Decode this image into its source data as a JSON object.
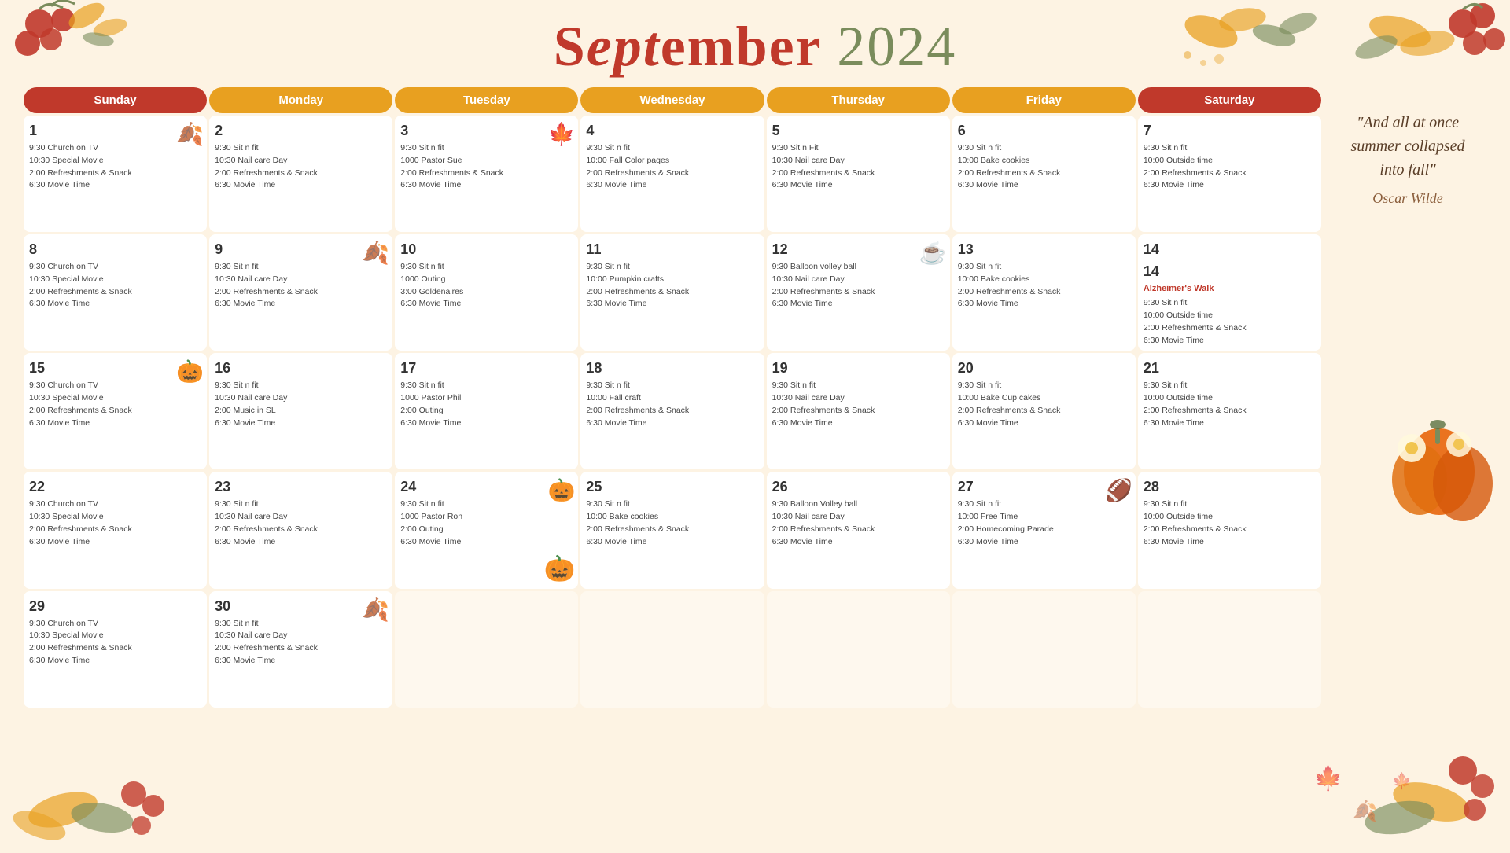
{
  "header": {
    "title_part1": "Sept",
    "title_em": "em",
    "title_part2": "ber",
    "year": "2024"
  },
  "days": [
    "Sunday",
    "Monday",
    "Tuesday",
    "Wednesday",
    "Thursday",
    "Friday",
    "Saturday"
  ],
  "cells": [
    {
      "num": "1",
      "events": [
        "9:30 Church on TV",
        "10:30 Special Movie",
        "2:00 Refreshments & Snack",
        "6:30 Movie Time"
      ],
      "deco": "🍂"
    },
    {
      "num": "2",
      "events": [
        "9:30 Sit n fit",
        "10:30 Nail care Day",
        "2:00 Refreshments & Snack",
        "6:30 Movie Time"
      ],
      "deco": ""
    },
    {
      "num": "3",
      "events": [
        "9:30 Sit n fit",
        "1000 Pastor Sue",
        "2:00 Refreshments & Snack",
        "6:30 Movie Time"
      ],
      "deco": "🍁"
    },
    {
      "num": "4",
      "events": [
        "9:30 Sit n fit",
        "10:00 Fall Color pages",
        "2:00 Refreshments & Snack",
        "6:30 Movie Time"
      ],
      "deco": ""
    },
    {
      "num": "5",
      "events": [
        "9:30 Sit n Fit",
        "10:30 Nail care Day",
        "2:00 Refreshments & Snack",
        "6:30 Movie Time"
      ],
      "deco": ""
    },
    {
      "num": "6",
      "events": [
        "9:30 Sit n fit",
        "10:00 Bake cookies",
        "2:00 Refreshments & Snack",
        "6:30 Movie Time"
      ],
      "deco": ""
    },
    {
      "num": "7",
      "events": [
        "9:30 Sit n fit",
        "10:00 Outside time",
        "2:00 Refreshments & Snack",
        "6:30 Movie Time"
      ],
      "deco": ""
    },
    {
      "num": "8",
      "events": [
        "9:30 Church on TV",
        "10:30 Special Movie",
        "2:00 Refreshments & Snack",
        "6:30 Movie Time"
      ],
      "deco": ""
    },
    {
      "num": "9",
      "events": [
        "9:30 Sit n fit",
        "10:30 Nail care Day",
        "2:00 Refreshments & Snack",
        "6:30 Movie Time"
      ],
      "deco": "🍂"
    },
    {
      "num": "10",
      "events": [
        "9:30 Sit n fit",
        "1000 Outing",
        "3:00 Goldenaires",
        "6:30 Movie Time"
      ],
      "deco": ""
    },
    {
      "num": "11",
      "events": [
        "9:30 Sit n fit",
        "10:00 Pumpkin crafts",
        "2:00 Refreshments & Snack",
        "6:30 Movie Time"
      ],
      "deco": ""
    },
    {
      "num": "12",
      "events": [
        "9:30 Balloon volley ball",
        "10:30 Nail care Day",
        "2:00 Refreshments & Snack",
        "6:30 Movie Time"
      ],
      "deco": "☕"
    },
    {
      "num": "13",
      "events": [
        "9:30 Sit n fit",
        "10:00 Bake cookies",
        "2:00 Refreshments & Snack",
        "6:30 Movie Time"
      ],
      "deco": ""
    },
    {
      "num": "14",
      "events": [],
      "special": "alzheimer",
      "deco": ""
    },
    {
      "num": "15",
      "events": [
        "9:30 Church on TV",
        "10:30 Special Movie",
        "2:00 Refreshments & Snack",
        "6:30 Movie Time"
      ],
      "deco": "🎃"
    },
    {
      "num": "16",
      "events": [
        "9:30 Sit n fit",
        "10:30 Nail care Day",
        "2:00 Music in SL",
        "6:30 Movie Time"
      ],
      "deco": ""
    },
    {
      "num": "17",
      "events": [
        "9:30 Sit n fit",
        "1000 Pastor Phil",
        "2:00 Outing",
        "6:30 Movie Time"
      ],
      "deco": ""
    },
    {
      "num": "18",
      "events": [
        "9:30 Sit n fit",
        "10:00 Fall craft",
        "2:00 Refreshments & Snack",
        "6:30 Movie Time"
      ],
      "deco": ""
    },
    {
      "num": "19",
      "events": [
        "9:30 Sit n fit",
        "10:30 Nail care Day",
        "2:00 Refreshments & Snack",
        "6:30 Movie Time"
      ],
      "deco": ""
    },
    {
      "num": "20",
      "events": [
        "9:30 Sit n fit",
        "10:00 Bake Cup cakes",
        "2:00 Refreshments & Snack",
        "6:30 Movie Time"
      ],
      "deco": ""
    },
    {
      "num": "21",
      "events": [
        "9:30 Sit n fit",
        "10:00 Outside time",
        "2:00 Refreshments & Snack",
        "6:30 Movie Time"
      ],
      "deco": ""
    },
    {
      "num": "22",
      "events": [
        "9:30 Church on TV",
        "10:30 Special Movie",
        "2:00 Refreshments & Snack",
        "6:30 Movie Time"
      ],
      "deco": ""
    },
    {
      "num": "23",
      "events": [
        "9:30 Sit n fit",
        "10:30 Nail care Day",
        "2:00 Refreshments & Snack",
        "6:30 Movie Time"
      ],
      "deco": ""
    },
    {
      "num": "24",
      "events": [
        "9:30 Sit n fit",
        "1000 Pastor Ron",
        "2:00 Outing",
        "6:30 Movie Time"
      ],
      "deco": "🎃"
    },
    {
      "num": "25",
      "events": [
        "9:30 Sit n fit",
        "10:00 Bake cookies",
        "2:00 Refreshments & Snack",
        "6:30 Movie Time"
      ],
      "deco": ""
    },
    {
      "num": "26",
      "events": [
        "9:30 Balloon Volley ball",
        "10:30 Nail care Day",
        "2:00 Refreshments & Snack",
        "6:30 Movie Time"
      ],
      "deco": ""
    },
    {
      "num": "27",
      "events": [
        "9:30 Sit n fit",
        "10:00 Free Time",
        "2:00 Homecoming Parade",
        "6:30 Movie Time"
      ],
      "deco": "🏈"
    },
    {
      "num": "28",
      "events": [
        "9:30 Sit n fit",
        "10:00 Outside time",
        "2:00 Refreshments & Snack",
        "6:30 Movie Time"
      ],
      "deco": ""
    },
    {
      "num": "29",
      "events": [
        "9:30 Church on TV",
        "10:30 Special Movie",
        "2:00 Refreshments & Snack",
        "6:30 Movie Time"
      ],
      "deco": ""
    },
    {
      "num": "30",
      "events": [
        "9:30 Sit n fit",
        "10:30 Nail care Day",
        "2:00 Refreshments & Snack",
        "6:30 Movie Time"
      ],
      "deco": "🍂"
    },
    {
      "num": "",
      "events": [],
      "deco": "",
      "empty": true
    },
    {
      "num": "",
      "events": [],
      "deco": "",
      "empty": true
    },
    {
      "num": "",
      "events": [],
      "deco": "",
      "empty": true
    },
    {
      "num": "",
      "events": [],
      "deco": "",
      "empty": true
    },
    {
      "num": "",
      "events": [],
      "deco": "",
      "empty": true
    }
  ],
  "sidebar": {
    "quote": "\"And all at once summer collapsed into fall\"",
    "author": "Oscar Wilde"
  },
  "alzheimer": {
    "title": "Alzheimer's Walk",
    "events": [
      "9:30 Sit n fit",
      "10:00 Outside time",
      "2:00 Refreshments & Snack",
      "6:30 Movie Time"
    ]
  },
  "day_classes": [
    "sunday",
    "monday",
    "tuesday",
    "wednesday",
    "thursday",
    "friday",
    "saturday"
  ]
}
